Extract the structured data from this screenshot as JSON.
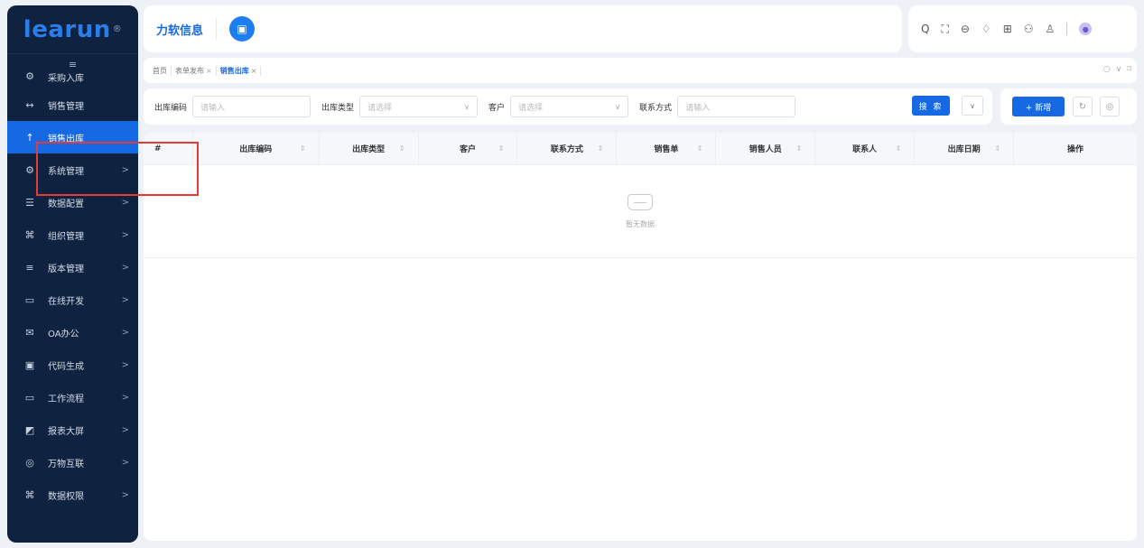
{
  "sidebar": {
    "logo": "learun",
    "logo_mark": "®",
    "collapse_icon": "≡",
    "items": [
      {
        "label": "采购入库",
        "icon": "⚙",
        "arrow": ""
      },
      {
        "label": "销售管理",
        "icon": "↔",
        "arrow": ""
      },
      {
        "label": "销售出库",
        "icon": "↑",
        "arrow": ""
      },
      {
        "label": "系统管理",
        "icon": "⚙",
        "arrow": ">"
      },
      {
        "label": "数据配置",
        "icon": "☰",
        "arrow": ">"
      },
      {
        "label": "组织管理",
        "icon": "⌘",
        "arrow": ">"
      },
      {
        "label": "版本管理",
        "icon": "≡",
        "arrow": ">"
      },
      {
        "label": "在线开发",
        "icon": "▭",
        "arrow": ">"
      },
      {
        "label": "OA办公",
        "icon": "✉",
        "arrow": ">"
      },
      {
        "label": "代码生成",
        "icon": "▣",
        "arrow": ">"
      },
      {
        "label": "工作流程",
        "icon": "▭",
        "arrow": ">"
      },
      {
        "label": "报表大屏",
        "icon": "◩",
        "arrow": ">"
      },
      {
        "label": "万物互联",
        "icon": "◎",
        "arrow": ">"
      },
      {
        "label": "数据权限",
        "icon": "⌘",
        "arrow": ">"
      }
    ]
  },
  "header": {
    "brand": "力软信息",
    "terminal_icon": "▣",
    "tools": [
      "Q",
      "⛶",
      "⊖",
      "♢",
      "⊞",
      "⚇",
      "♙"
    ],
    "avatar": "●"
  },
  "breadcrumb": {
    "tabs": [
      {
        "label": "首页",
        "close": ""
      },
      {
        "label": "表单发布",
        "close": "×"
      },
      {
        "label": "销售出库",
        "close": "×"
      }
    ],
    "tools": [
      "○",
      "∨",
      "⌑"
    ]
  },
  "search": {
    "fields": [
      {
        "label": "出库编码",
        "placeholder": "请输入",
        "dropdown": ""
      },
      {
        "label": "出库类型",
        "placeholder": "请选择",
        "dropdown": "∨"
      },
      {
        "label": "客户",
        "placeholder": "请选择",
        "dropdown": "∨"
      },
      {
        "label": "联系方式",
        "placeholder": "请输入",
        "dropdown": ""
      }
    ],
    "search_label": "搜 索",
    "expand_icon": "∨"
  },
  "actions": {
    "add_label": "+ 新增",
    "refresh_icon": "↻",
    "settings_icon": "◎"
  },
  "table": {
    "columns": [
      "#",
      "出库编码",
      "出库类型",
      "客户",
      "联系方式",
      "销售单",
      "销售人员",
      "联系人",
      "出库日期",
      "操作"
    ],
    "sort_icon": "⇕",
    "empty_text": "暂无数据"
  }
}
